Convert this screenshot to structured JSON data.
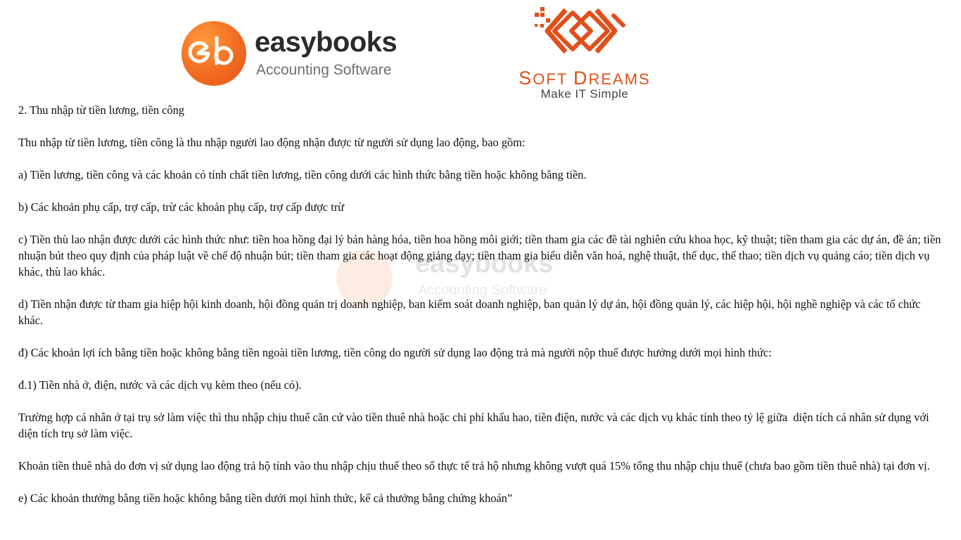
{
  "header": {
    "easybooks": {
      "name": "easybooks",
      "tagline": "Accounting Software",
      "icon": "eb-logo-icon",
      "brand_color": "#f26b21"
    },
    "softdreams": {
      "name_part1_big": "S",
      "name_part1": "OFT ",
      "name_part2_big": "D",
      "name_part2": "REAMS",
      "tagline": "Make IT Simple",
      "icon": "softdreams-logo-icon",
      "brand_color": "#e0501b"
    }
  },
  "watermark": {
    "name": "easybooks",
    "tagline": "Accounting Software"
  },
  "document": {
    "heading": "2. Thu nhập từ tiền lương, tiền công",
    "paragraphs": [
      "Thu nhập từ tiền lương, tiền công là thu nhập người lao động nhận được từ người sử dụng lao động, bao gồm:",
      "a) Tiền lương, tiền công và các khoản có tính chất tiền lương, tiền công dưới các hình thức bằng tiền hoặc không bằng tiền.",
      "b) Các khoản phụ cấp, trợ cấp, trừ các khoản phụ cấp, trợ cấp được trừ",
      "c) Tiền thù lao nhận được dưới các hình thức như: tiền hoa hồng đại lý bán hàng hóa, tiền hoa hồng môi giới; tiền tham gia các đề tài nghiên cứu khoa học, kỹ thuật; tiền tham gia các dự án, đề án; tiền nhuận bút theo quy định của pháp luật về chế độ nhuận bút; tiền tham gia các hoạt động giảng dạy; tiền tham gia biểu diễn văn hoá, nghệ thuật, thể dục, thể thao; tiền dịch vụ quảng cáo; tiền dịch vụ khác, thù lao khác.",
      "d) Tiền nhận được từ tham gia hiệp hội kinh doanh, hội đồng quản trị doanh nghiệp, ban kiểm soát doanh nghiệp, ban quản lý dự án, hội đồng quản lý, các hiệp hội, hội nghề nghiệp và các tổ chức khác.",
      "đ) Các khoản lợi ích bằng tiền hoặc không bằng tiền ngoài tiền lương, tiền công do người sử dụng lao động trả mà người nộp thuế được hưởng dưới mọi hình thức:",
      "đ.1) Tiền nhà ở, điện, nước và các dịch vụ kèm theo (nếu có).",
      "Trường hợp cá nhân ở tại trụ sở làm việc thì thu nhập chịu thuế căn cứ vào tiền thuê nhà hoặc chi phí khấu hao, tiền điện, nước và các dịch vụ khác tính theo tỷ lệ giữa  diện tích cá nhân sử dụng với diện tích trụ sở làm việc.",
      "Khoản tiền thuê nhà do đơn vị sử dụng lao động trả hộ tính vào thu nhập chịu thuế theo số thực tế trả hộ nhưng không vượt quá 15% tổng thu nhập chịu thuế (chưa bao gồm tiền thuê nhà) tại đơn vị.",
      "e) Các khoản thưởng bằng tiền hoặc không bằng tiền dưới mọi hình thức, kể cả thưởng bằng chứng khoán”"
    ]
  }
}
